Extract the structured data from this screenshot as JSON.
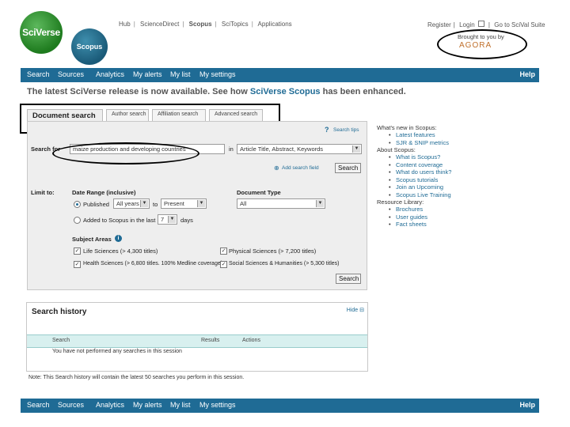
{
  "logos": {
    "sciverse": "SciVerse",
    "scopus": "Scopus"
  },
  "top_links": [
    "Hub",
    "ScienceDirect",
    "Scopus",
    "SciTopics",
    "Applications"
  ],
  "right_links": {
    "register": "Register",
    "login": "Login",
    "goto": "Go to SciVal Suite"
  },
  "brought_by": "Brought to you by",
  "agora": "AGORA",
  "nav": {
    "items": [
      "Search",
      "Sources",
      "Analytics",
      "My alerts",
      "My list",
      "My settings"
    ],
    "help": "Help"
  },
  "announcement": {
    "prefix": "The latest SciVerse release is now available. See how ",
    "link": "SciVerse Scopus",
    "suffix": " has been enhanced."
  },
  "tabs": [
    "Document search",
    "Author search",
    "Affiliation search",
    "Advanced search"
  ],
  "search": {
    "tips": "Search tips",
    "search_for_label": "Search for",
    "query": "maize production and developing countries",
    "in_label": "in",
    "field": "Article Title, Abstract, Keywords",
    "add_field": "Add search field",
    "search_button": "Search"
  },
  "limits": {
    "limit_to": "Limit to:",
    "date_range_label": "Date Range (inclusive)",
    "published_label": "Published",
    "from": "All years",
    "to_label": "to",
    "to": "Present",
    "added_label": "Added to Scopus in the last",
    "days_value": "7",
    "days_label": "days",
    "doc_type_label": "Document Type",
    "doc_type": "All"
  },
  "subject_areas": {
    "label": "Subject Areas",
    "items": [
      "Life Sciences (> 4,300 titles)",
      "Physical Sciences (> 7,200 titles)",
      "Health Sciences (> 6,800 titles. 100% Medline coverage)",
      "Social Sciences & Humanities (> 5,300 titles)"
    ]
  },
  "search_button2": "Search",
  "right_column": {
    "whats_new": "What's new in Scopus:",
    "whats_new_items": [
      "Latest features",
      "SJR & SNIP metrics"
    ],
    "about": "About Scopus:",
    "about_items": [
      "What is Scopus?",
      "Content coverage",
      "What do users think?",
      "Scopus tutorials",
      "Join an Upcoming",
      "Scopus Live Training"
    ],
    "resource": "Resource Library:",
    "resource_items": [
      "Brochures",
      "User guides",
      "Fact sheets"
    ]
  },
  "history": {
    "title": "Search history",
    "hide": "Hide",
    "columns": [
      "Search",
      "Results",
      "Actions"
    ],
    "empty": "You have not performed any searches in this session"
  },
  "note": "Note: This Search history will contain the latest 50 searches you perform in this session."
}
